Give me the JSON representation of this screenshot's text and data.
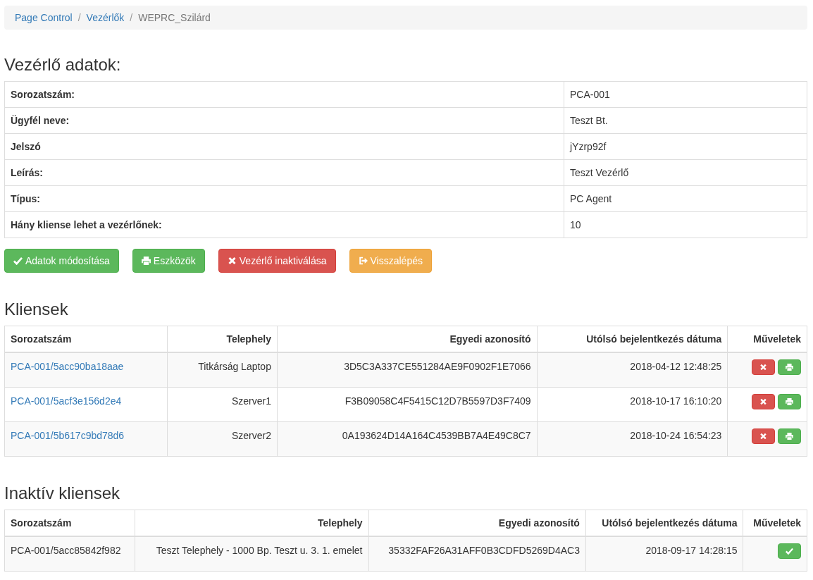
{
  "breadcrumb": [
    {
      "label": "Page Control",
      "kind": "link"
    },
    {
      "label": "/",
      "kind": "separator"
    },
    {
      "label": "Vezérlők",
      "kind": "link"
    },
    {
      "label": "/",
      "kind": "separator"
    },
    {
      "label": "WEPRC_Szilárd",
      "kind": "current"
    }
  ],
  "details": {
    "title": "Vezérlő adatok:",
    "rows": [
      {
        "label": "Sorozatszám:",
        "value": "PCA-001"
      },
      {
        "label": "Ügyfél neve:",
        "value": "Teszt Bt."
      },
      {
        "label": "Jelszó",
        "value": "jYzrp92f"
      },
      {
        "label": "Leírás:",
        "value": "Teszt Vezérlő"
      },
      {
        "label": "Típus:",
        "value": "PC Agent"
      },
      {
        "label": "Hány kliense lehet a vezérlőnek:",
        "value": "10"
      }
    ]
  },
  "buttons": [
    {
      "label": "Adatok módosítása",
      "kind": "save"
    },
    {
      "label": "Eszközök",
      "kind": "tools"
    },
    {
      "label": "Vezérlő inaktiválása",
      "kind": "deactivate"
    },
    {
      "label": "Visszalépés",
      "kind": "back"
    }
  ],
  "clients": {
    "title": "Kliensek",
    "columns": [
      "Sorozatszám",
      "Telephely",
      "Egyedi azonosító",
      "Utólsó bejelentkezés dátuma",
      "Műveletek"
    ],
    "rows": [
      {
        "serial": "PCA-001/5acc90ba18aae",
        "site": "Titkárság Laptop",
        "id": "3D5C3A337CE551284AE9F0902F1E7066",
        "last_login": "2018-04-12 12:48:25",
        "actions": [
          {
            "kind": "delete"
          },
          {
            "kind": "print"
          }
        ]
      },
      {
        "serial": "PCA-001/5acf3e156d2e4",
        "site": "Szerver1",
        "id": "F3B09058C4F5415C12D7B5597D3F7409",
        "last_login": "2018-10-17 16:10:20",
        "actions": [
          {
            "kind": "delete"
          },
          {
            "kind": "print"
          }
        ]
      },
      {
        "serial": "PCA-001/5b617c9bd78d6",
        "site": "Szerver2",
        "id": "0A193624D14A164C4539BB7A4E49C8C7",
        "last_login": "2018-10-24 16:54:23",
        "actions": [
          {
            "kind": "delete"
          },
          {
            "kind": "print"
          }
        ]
      }
    ]
  },
  "inactive_clients": {
    "title": "Inaktív kliensek",
    "columns": [
      "Sorozatszám",
      "Telephely",
      "Egyedi azonosító",
      "Utólsó bejelentkezés dátuma",
      "Műveletek"
    ],
    "rows": [
      {
        "serial": "PCA-001/5acc85842f982",
        "site": "Teszt Telephely - 1000 Bp. Teszt u. 3. 1. emelet",
        "id": "35332FAF26A31AFF0B3CDFD5269D4AC3",
        "last_login": "2018-09-17 14:28:15",
        "actions": [
          {
            "kind": "activate"
          }
        ]
      }
    ]
  }
}
